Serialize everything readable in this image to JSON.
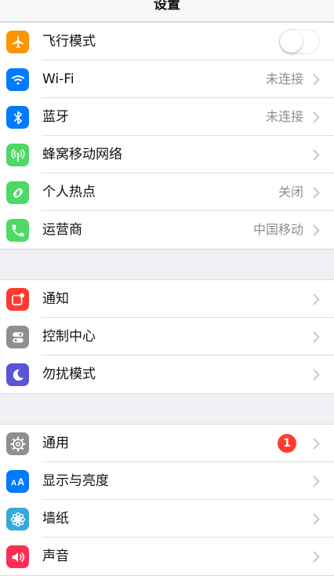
{
  "nav": {
    "title": "设置"
  },
  "groups": [
    {
      "items": [
        {
          "label": "飞行模式",
          "icon": "airplane-icon",
          "icon_color": "#ff9500",
          "toggle": "off"
        },
        {
          "label": "Wi-Fi",
          "icon": "wifi-icon",
          "icon_color": "#007aff",
          "value": "未连接"
        },
        {
          "label": "蓝牙",
          "icon": "bluetooth-icon",
          "icon_color": "#007aff",
          "value": "未连接"
        },
        {
          "label": "蜂窝移动网络",
          "icon": "cellular-icon",
          "icon_color": "#4cd964"
        },
        {
          "label": "个人热点",
          "icon": "hotspot-icon",
          "icon_color": "#4cd964",
          "value": "关闭"
        },
        {
          "label": "运营商",
          "icon": "phone-icon",
          "icon_color": "#4cd964",
          "value": "中国移动"
        }
      ]
    },
    {
      "items": [
        {
          "label": "通知",
          "icon": "notifications-icon",
          "icon_color": "#ff3b30"
        },
        {
          "label": "控制中心",
          "icon": "control-center-icon",
          "icon_color": "#8e8e93"
        },
        {
          "label": "勿扰模式",
          "icon": "moon-icon",
          "icon_color": "#5856d6"
        }
      ]
    },
    {
      "items": [
        {
          "label": "通用",
          "icon": "gear-icon",
          "icon_color": "#8e8e93",
          "badge": "1"
        },
        {
          "label": "显示与亮度",
          "icon": "display-brightness-icon",
          "icon_color": "#007aff"
        },
        {
          "label": "墙纸",
          "icon": "wallpaper-icon",
          "icon_color": "#34aadc"
        },
        {
          "label": "声音",
          "icon": "speaker-icon",
          "icon_color": "#ff2d55"
        }
      ]
    }
  ]
}
